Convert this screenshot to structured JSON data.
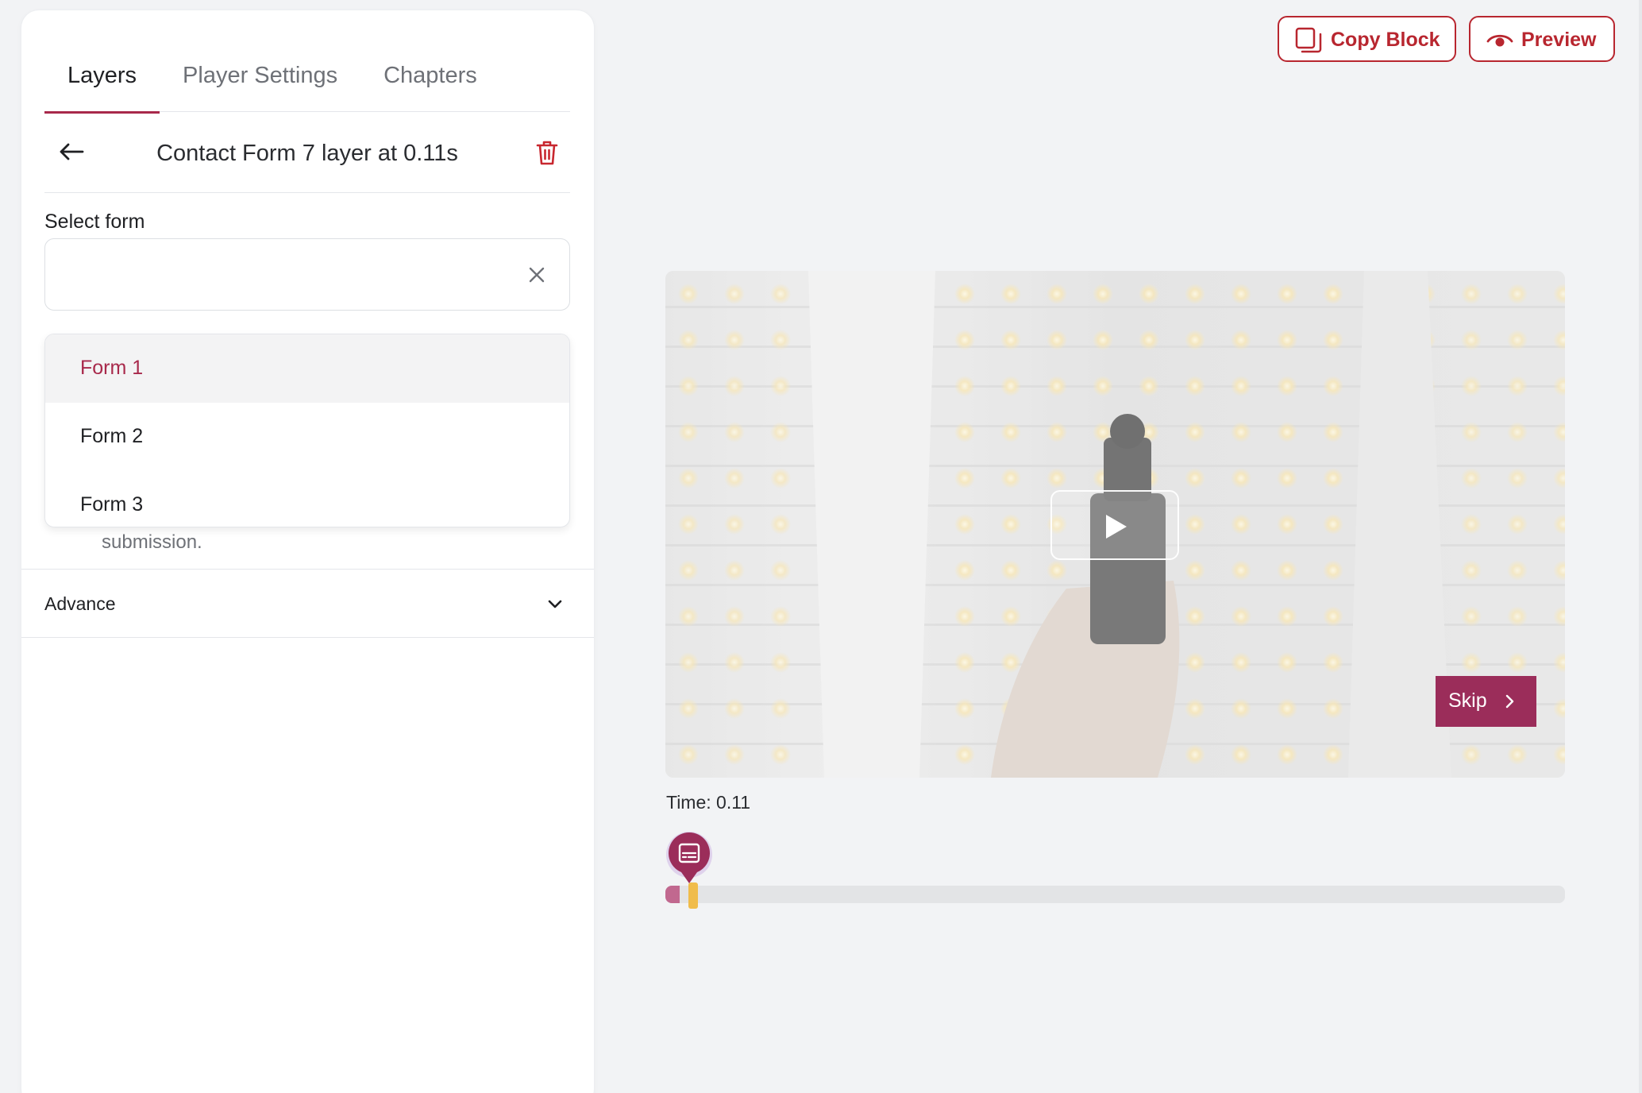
{
  "tabs": [
    {
      "label": "Layers",
      "active": true
    },
    {
      "label": "Player Settings",
      "active": false
    },
    {
      "label": "Chapters",
      "active": false
    }
  ],
  "layer": {
    "title": "Contact Form 7 layer at 0.11s"
  },
  "form_select": {
    "label": "Select form",
    "value": "",
    "options": [
      {
        "label": "Form 1",
        "highlighted": true
      },
      {
        "label": "Form 2",
        "highlighted": false
      },
      {
        "label": "Form 3",
        "highlighted": false
      }
    ],
    "helper_text": "submission."
  },
  "advance": {
    "label": "Advance"
  },
  "toolbar": {
    "copy_label": "Copy Block",
    "preview_label": "Preview"
  },
  "video": {
    "skip_label": "Skip",
    "time_text": "Time: 0.11",
    "progress_fraction": 0.011,
    "playhead_fraction": 0.026
  },
  "colors": {
    "accent": "#9b2d5a",
    "danger": "#b8262f",
    "playhead": "#f0bc4b"
  },
  "icons": {
    "back": "arrow-left-icon",
    "delete": "trash-icon",
    "clear": "close-icon",
    "copy": "copy-icon",
    "preview": "eye-icon",
    "play": "play-icon",
    "skip": "chevron-right-icon",
    "advance": "chevron-down-icon",
    "marker": "subtitles-icon"
  }
}
